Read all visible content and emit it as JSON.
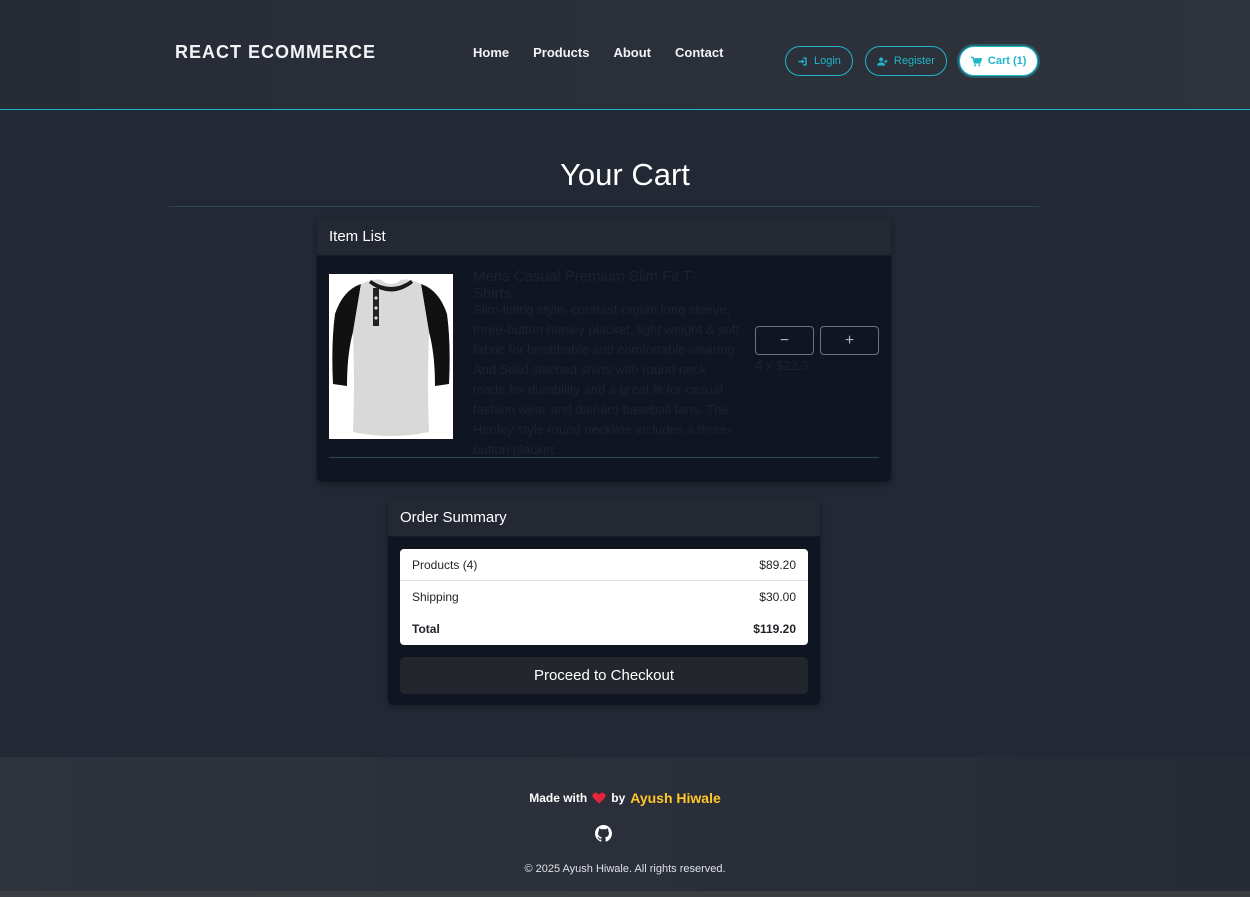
{
  "navbar": {
    "brand": "REACT ECOMMERCE",
    "links": [
      "Home",
      "Products",
      "About",
      "Contact"
    ],
    "login_label": "Login",
    "register_label": "Register",
    "cart_label": "Cart (1)",
    "accent_color": "#1fb6c9"
  },
  "main": {
    "title": "Your Cart",
    "item_list": {
      "header": "Item List",
      "item": {
        "image": "henley-tshirt-image",
        "title": "Mens Casual Premium Slim Fit T-Shirts",
        "description": "Slim-fitting style, contrast raglan long sleeve, three-button henley placket, light weight & soft fabric for breathable and comfortable wearing. And Solid stitched shirts with round neck made for durability and a great fit for casual fashion wear and diehard baseball fans. The Henley style round neckline includes a three-button placket.",
        "quantity_text": "4 x $22.3",
        "decrement_icon": "minus-icon",
        "increment_icon": "plus-icon"
      }
    },
    "order_summary": {
      "header": "Order Summary",
      "products_label": "Products (4)",
      "products_value": "$89.20",
      "shipping_label": "Shipping",
      "shipping_value": "$30.00",
      "total_label": "Total",
      "total_value": "$119.20",
      "checkout_label": "Proceed to Checkout"
    }
  },
  "footer": {
    "made_with": "Made with",
    "by": "by",
    "author": "Ayush Hiwale",
    "heart_icon": "heart-icon",
    "github_icon": "github-icon",
    "copyright": "© 2025 Ayush Hiwale. All rights reserved.",
    "author_color": "#ffc828"
  }
}
